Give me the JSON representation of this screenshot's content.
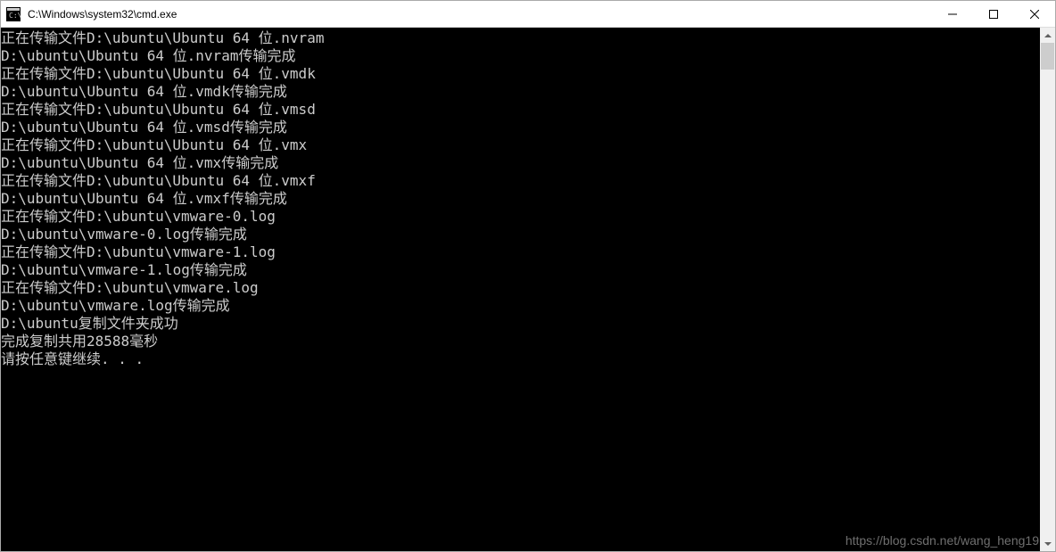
{
  "window": {
    "title": "C:\\Windows\\system32\\cmd.exe"
  },
  "terminal": {
    "lines": [
      "正在传输文件D:\\ubuntu\\Ubuntu 64 位.nvram",
      "D:\\ubuntu\\Ubuntu 64 位.nvram传输完成",
      "正在传输文件D:\\ubuntu\\Ubuntu 64 位.vmdk",
      "D:\\ubuntu\\Ubuntu 64 位.vmdk传输完成",
      "正在传输文件D:\\ubuntu\\Ubuntu 64 位.vmsd",
      "D:\\ubuntu\\Ubuntu 64 位.vmsd传输完成",
      "正在传输文件D:\\ubuntu\\Ubuntu 64 位.vmx",
      "D:\\ubuntu\\Ubuntu 64 位.vmx传输完成",
      "正在传输文件D:\\ubuntu\\Ubuntu 64 位.vmxf",
      "D:\\ubuntu\\Ubuntu 64 位.vmxf传输完成",
      "正在传输文件D:\\ubuntu\\vmware-0.log",
      "D:\\ubuntu\\vmware-0.log传输完成",
      "正在传输文件D:\\ubuntu\\vmware-1.log",
      "D:\\ubuntu\\vmware-1.log传输完成",
      "正在传输文件D:\\ubuntu\\vmware.log",
      "D:\\ubuntu\\vmware.log传输完成",
      "D:\\ubuntu复制文件夹成功",
      "完成复制共用28588毫秒",
      "请按任意键继续. . ."
    ]
  },
  "watermark": "https://blog.csdn.net/wang_heng19"
}
